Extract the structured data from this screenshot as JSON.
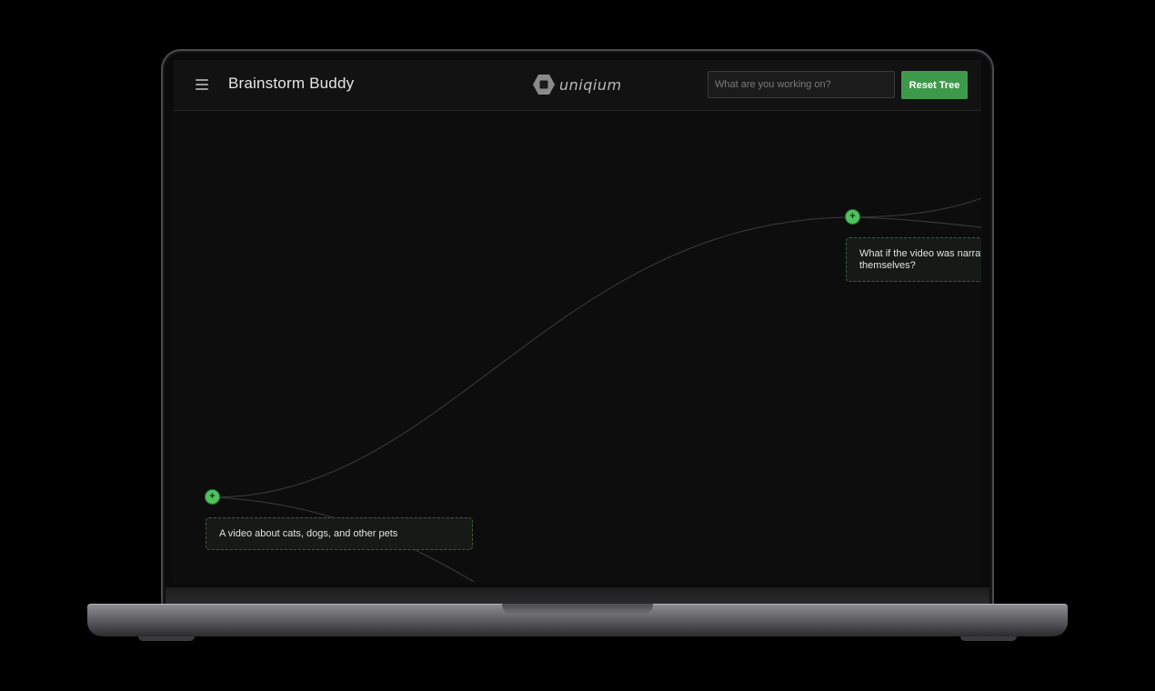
{
  "header": {
    "app_title": "Brainstorm Buddy",
    "logo_text": "uniqium",
    "search_placeholder": "What are you working on?",
    "reset_label": "Reset Tree"
  },
  "nodes": [
    {
      "id": "root",
      "text": "A video about cats, dogs, and other pets"
    },
    {
      "id": "child-1",
      "text": "What if the video was narrated by the pets themselves?"
    }
  ],
  "colors": {
    "accent": "#3d9a4a",
    "node_dot": "#4ec25e",
    "canvas": "#0d0d0d",
    "header": "#121212"
  },
  "icons": {
    "menu": "hamburger-menu-icon",
    "logo": "hexagon-logo-icon",
    "expand": "plus-icon"
  }
}
